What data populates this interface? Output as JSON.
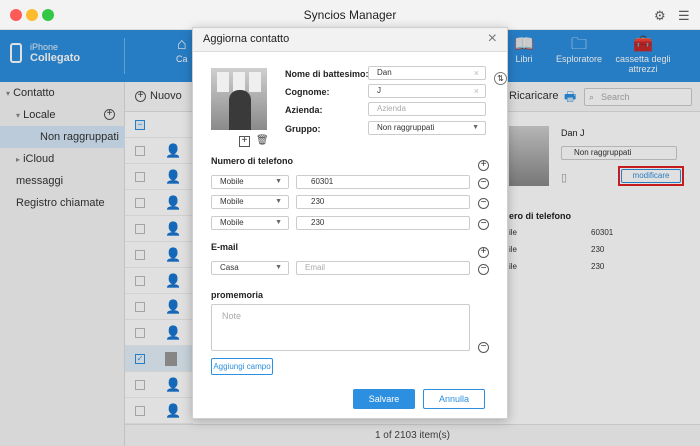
{
  "app": {
    "title": "Syncios Manager"
  },
  "device": {
    "name": "iPhone",
    "status": "Collegato"
  },
  "nav": {
    "items": [
      {
        "label": "Ca",
        "icon": "home-icon"
      },
      {
        "label": "Libri",
        "icon": "book-icon"
      },
      {
        "label": "Esploratore",
        "icon": "folder-icon"
      },
      {
        "label": "cassetta degli attrezzi",
        "icon": "toolbox-icon"
      }
    ]
  },
  "sidebar": {
    "items": [
      {
        "label": "Contatto"
      },
      {
        "label": "Locale"
      },
      {
        "label": "Non raggruppati"
      },
      {
        "label": "iCloud"
      },
      {
        "label": "messaggi"
      },
      {
        "label": "Registro chiamate"
      }
    ]
  },
  "toolbar": {
    "new_label": "Nuovo",
    "reload_label": "Ricaricare",
    "search_placeholder": "Search"
  },
  "detail": {
    "name": "Dan J",
    "group": "Non raggruppati",
    "edit_label": "modificare",
    "phone_title": "ero di telefono",
    "phones": [
      {
        "type": "ile",
        "number": "60301"
      },
      {
        "type": "ile",
        "number": "230"
      },
      {
        "type": "ile",
        "number": "230"
      }
    ]
  },
  "footer": {
    "count": "1 of 2103 item(s)"
  },
  "dialog": {
    "title": "Aggiorna contatto",
    "first_name_label": "Nome di battesimo:",
    "first_name": "Dan",
    "last_name_label": "Cognome:",
    "last_name": "J",
    "company_label": "Azienda:",
    "company_placeholder": "Azienda",
    "group_label": "Gruppo:",
    "group": "Non raggruppati",
    "phone_section": "Numero di telefono",
    "phones": [
      {
        "type": "Mobile",
        "number": "60301"
      },
      {
        "type": "Mobile",
        "number": "230"
      },
      {
        "type": "Mobile",
        "number": "230"
      }
    ],
    "email_section": "E-mail",
    "email_type": "Casa",
    "email_placeholder": "Email",
    "notes_section": "promemoria",
    "notes_placeholder": "Note",
    "add_field_label": "Aggiungi campo",
    "save_label": "Salvare",
    "cancel_label": "Annulla"
  },
  "colors": {
    "accent": "#2d8fe0",
    "highlight": "#e02020"
  }
}
